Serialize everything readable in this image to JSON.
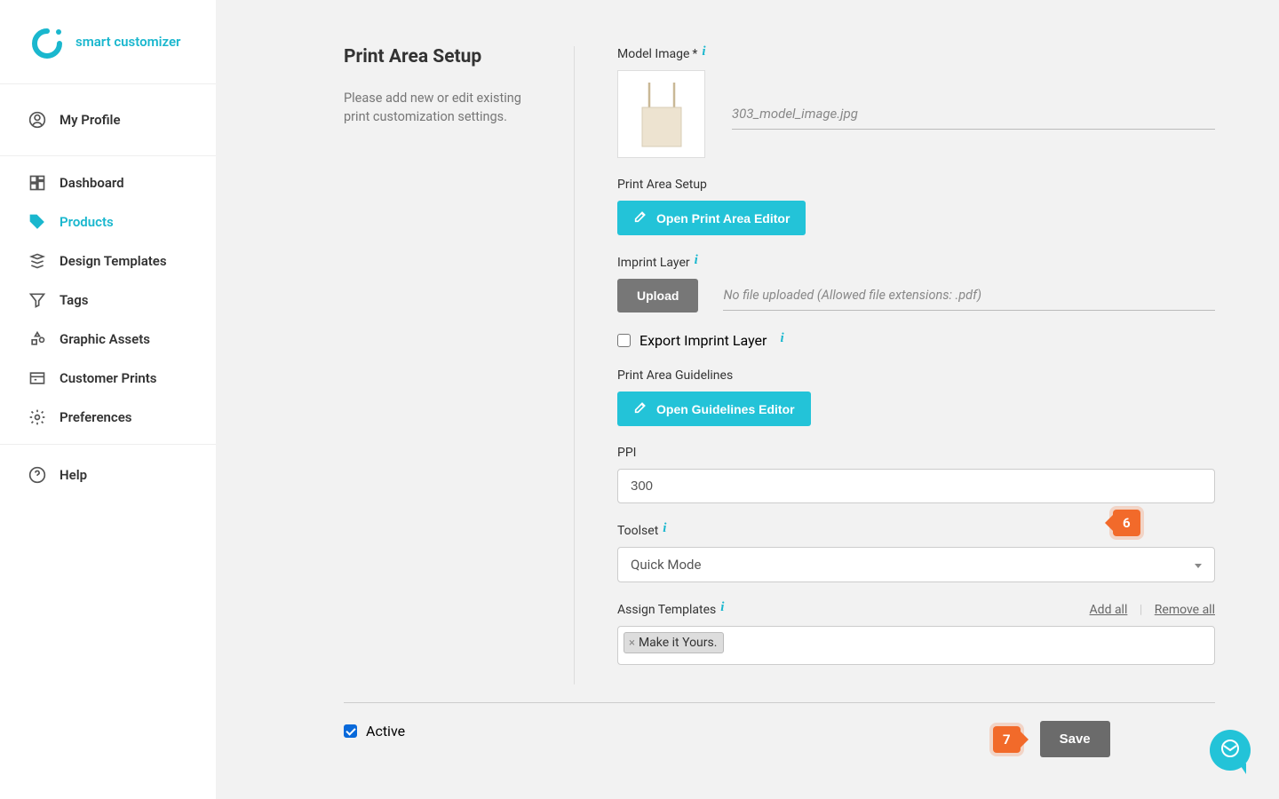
{
  "brand": "smart customizer",
  "sidebar": {
    "profile": "My Profile",
    "items": [
      "Dashboard",
      "Products",
      "Design Templates",
      "Tags",
      "Graphic Assets",
      "Customer Prints",
      "Preferences"
    ],
    "help": "Help",
    "activeIndex": 1
  },
  "leftPanel": {
    "title": "Print Area Setup",
    "description": "Please add new or edit existing print customization settings."
  },
  "fields": {
    "modelImage": {
      "label": "Model Image",
      "required": "*",
      "filename": "303_model_image.jpg"
    },
    "printAreaSetup": {
      "label": "Print Area Setup",
      "button": "Open Print Area Editor"
    },
    "imprintLayer": {
      "label": "Imprint Layer",
      "button": "Upload",
      "placeholder": "No file uploaded (Allowed file extensions: .pdf)"
    },
    "exportImprint": {
      "label": "Export Imprint Layer"
    },
    "guidelines": {
      "label": "Print Area Guidelines",
      "button": "Open Guidelines Editor"
    },
    "ppi": {
      "label": "PPI",
      "value": "300"
    },
    "toolset": {
      "label": "Toolset",
      "value": "Quick Mode"
    },
    "assignTemplates": {
      "label": "Assign Templates",
      "addAll": "Add all",
      "removeAll": "Remove all",
      "tag": "Make it Yours."
    },
    "active": {
      "label": "Active",
      "checked": true
    }
  },
  "badges": {
    "step6": "6",
    "step7": "7"
  },
  "buttons": {
    "save": "Save"
  }
}
